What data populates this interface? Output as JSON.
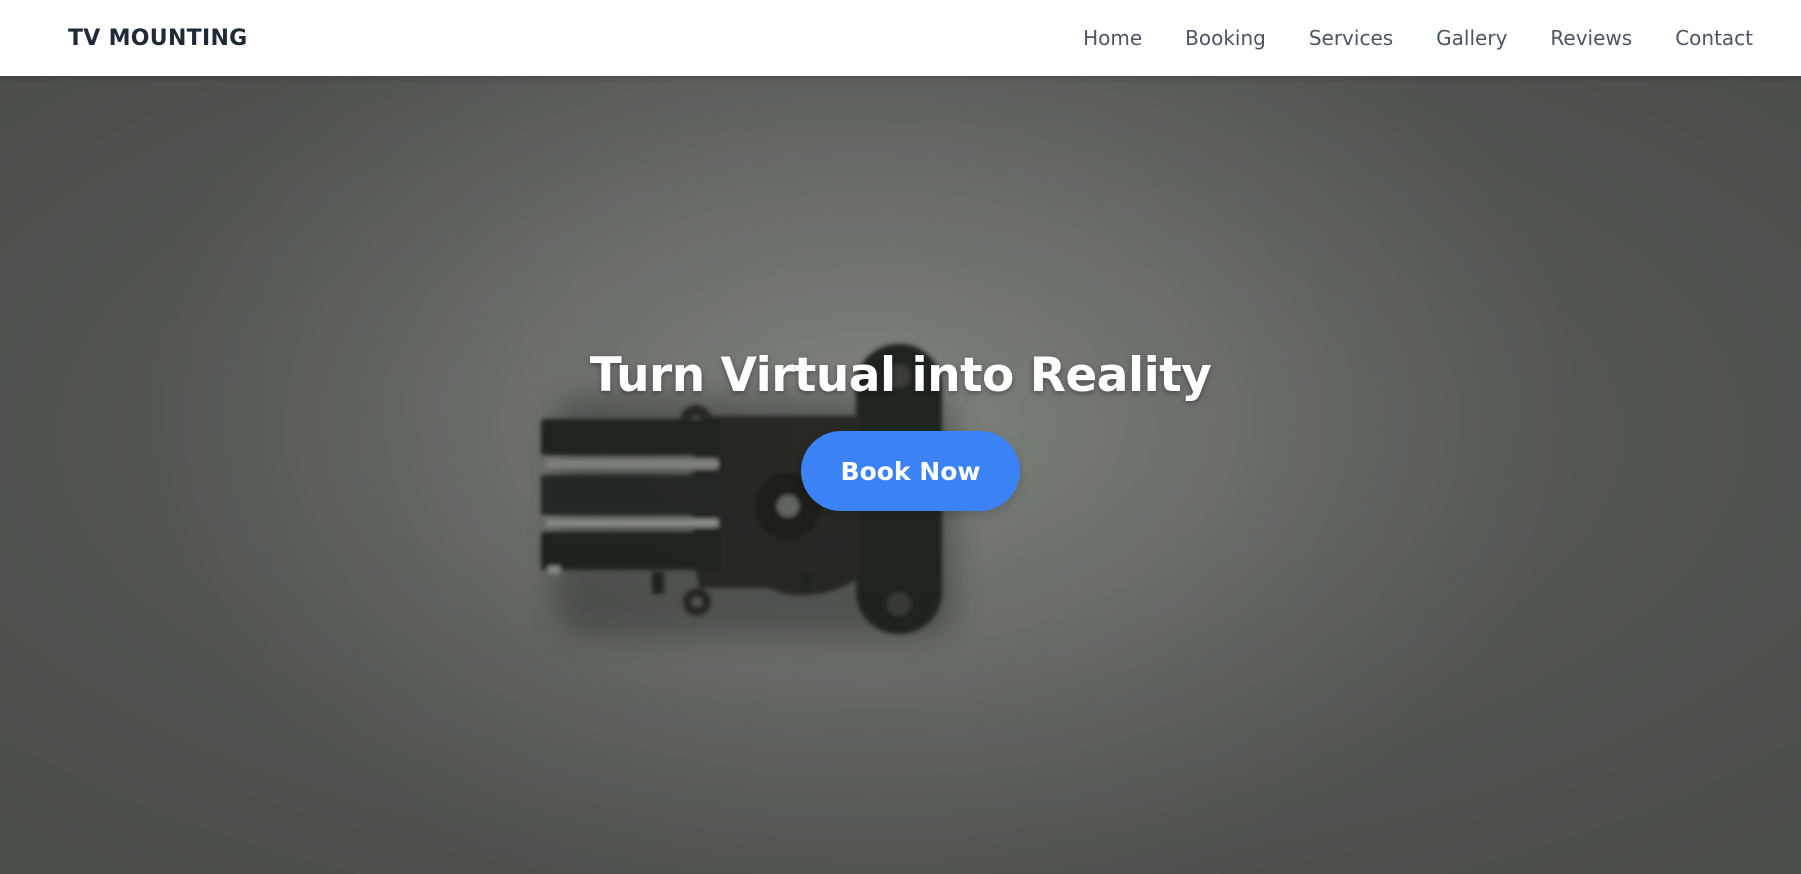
{
  "nav": {
    "brand": "TV MOUNTING",
    "links": [
      {
        "label": "Home"
      },
      {
        "label": "Booking"
      },
      {
        "label": "Services"
      },
      {
        "label": "Gallery"
      },
      {
        "label": "Reviews"
      },
      {
        "label": "Contact"
      }
    ]
  },
  "hero": {
    "title": "Turn Virtual into Reality",
    "cta_label": "Book Now",
    "background_subject": "tv-wall-mount-bracket-photo"
  },
  "colors": {
    "accent": "#3b82f6",
    "brand_text": "#1f2937",
    "nav_text": "#4b5563",
    "hero_bg": "#7b7e79"
  }
}
